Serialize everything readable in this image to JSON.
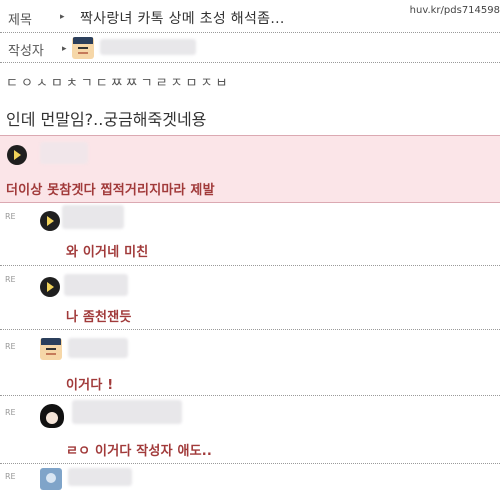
{
  "header": {
    "title_label": "제목",
    "title": "짝사랑녀 카톡 상메 초성 해석좀...",
    "source_url": "huv.kr/pds714598",
    "author_label": "작성자"
  },
  "post": {
    "line1": "ㄷㅇㅅㅁㅊㄱㄷㅉㅉㄱㄹㅈㅁㅈㅂ",
    "line2": "인데 먼말임?..궁금해죽겟네용"
  },
  "comments": [
    {
      "text": "더이상 못참겟다 찝적거리지마라 제발"
    }
  ],
  "replies": [
    {
      "re": "RE",
      "text": "와 이거네 미친"
    },
    {
      "re": "RE",
      "text": "나 좀천잰듯"
    },
    {
      "re": "RE",
      "text": "이거다 !"
    },
    {
      "re": "RE",
      "text": "ㄹㅇ 이거다 작성자 애도.."
    },
    {
      "re": "RE",
      "text": ""
    }
  ],
  "icons": {
    "arrow": "▸",
    "author_avatar": "graduate-avatar-icon",
    "pac_avatar": "pacman-avatar-icon"
  },
  "colors": {
    "highlight_bg": "#fbe5e8",
    "comment_text": "#a13a3a",
    "divider": "#9a9a9a"
  }
}
